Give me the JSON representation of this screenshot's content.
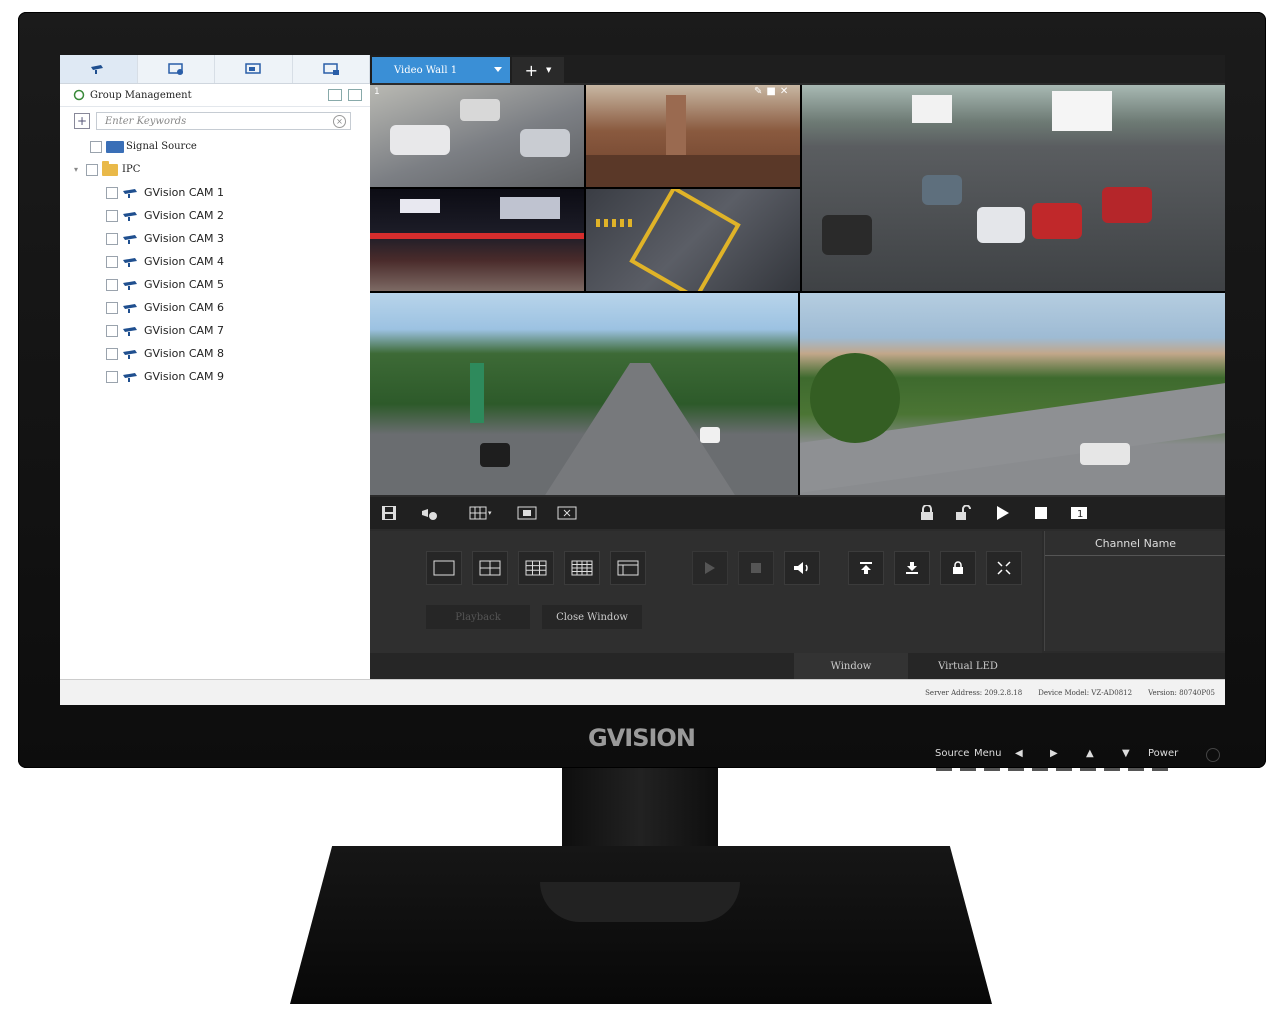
{
  "brand": {
    "logo_text": "GVISION"
  },
  "left_panel": {
    "tabs": [
      {
        "icon": "camera-icon"
      },
      {
        "icon": "monitor-icon"
      },
      {
        "icon": "screen-icon"
      },
      {
        "icon": "display-icon"
      }
    ],
    "group_title": "Group Management",
    "search_placeholder": "Enter Keywords",
    "tree": {
      "signal_source": "Signal Source",
      "ipc": "IPC",
      "cameras": [
        "GVision CAM 1",
        "GVision CAM 2",
        "GVision CAM 3",
        "GVision CAM 4",
        "GVision CAM 5",
        "GVision CAM 6",
        "GVision CAM 7",
        "GVision CAM 8",
        "GVision CAM 9"
      ]
    }
  },
  "right_panel": {
    "active_tab": "Video Wall 1",
    "add_tab_label": "+",
    "window_index": "1",
    "buttons": {
      "playback": "Playback",
      "close_window": "Close Window"
    },
    "channel_header": "Channel Name",
    "bottom_tabs": [
      "Window",
      "Virtual LED"
    ]
  },
  "status_bar": {
    "server_address": "Server Address: 209.2.8.18",
    "device_model": "Device Model: VZ-AD0812",
    "version": "Version: 80740P05"
  },
  "hardware_buttons": [
    "Source",
    "Menu",
    "◀",
    "▶",
    "▲",
    "▼",
    "Power"
  ]
}
